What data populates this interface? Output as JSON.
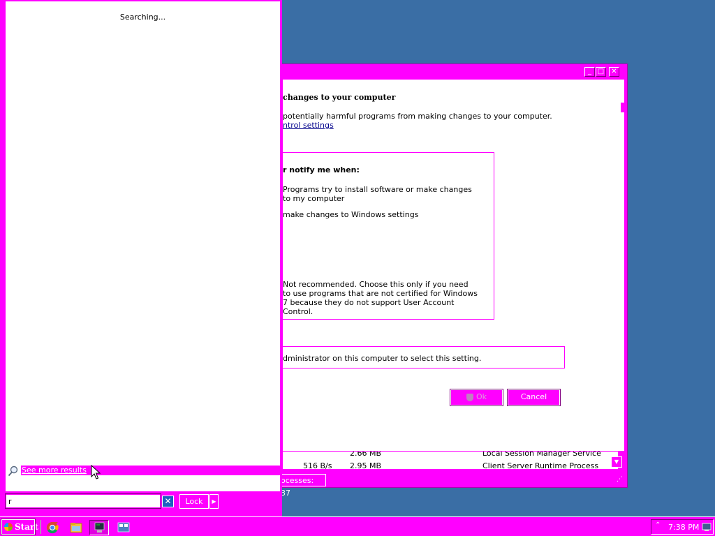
{
  "uac_window": {
    "heading": "changes to your computer",
    "description": "potentially harmful programs from making changes to your computer.",
    "link": "ntrol settings",
    "notify_title": "r notify me when:",
    "option1": "Programs try to install software or make changes to my computer",
    "option2": " make changes to Windows settings",
    "option3": "Not recommended. Choose this only if you need to use programs that are not certified for Windows 7 because they do not support User Account Control.",
    "admin_note": "dministrator on this computer to select this setting.",
    "ok_label": "Ok",
    "cancel_label": "Cancel",
    "process_rows": [
      {
        "net": "",
        "mem": "2.66 MB",
        "desc": "Local Session Manager Service"
      },
      {
        "net": "516 B/s",
        "mem": "2.95 MB",
        "desc": "Client Server Runtime Process"
      }
    ],
    "status": "ocesses: 37"
  },
  "start_menu": {
    "searching_text": "Searching...",
    "see_more_label": "See more results",
    "search_value": "r",
    "lock_label": "Lock"
  },
  "taskbar": {
    "start_label": "Start",
    "clock": "7:38 PM",
    "icons": [
      "chrome-icon",
      "folder-icon",
      "terminal-icon",
      "network-monitor-icon"
    ]
  },
  "colors": {
    "accent": "#ff00ff",
    "desktop": "#3a6ea5"
  }
}
